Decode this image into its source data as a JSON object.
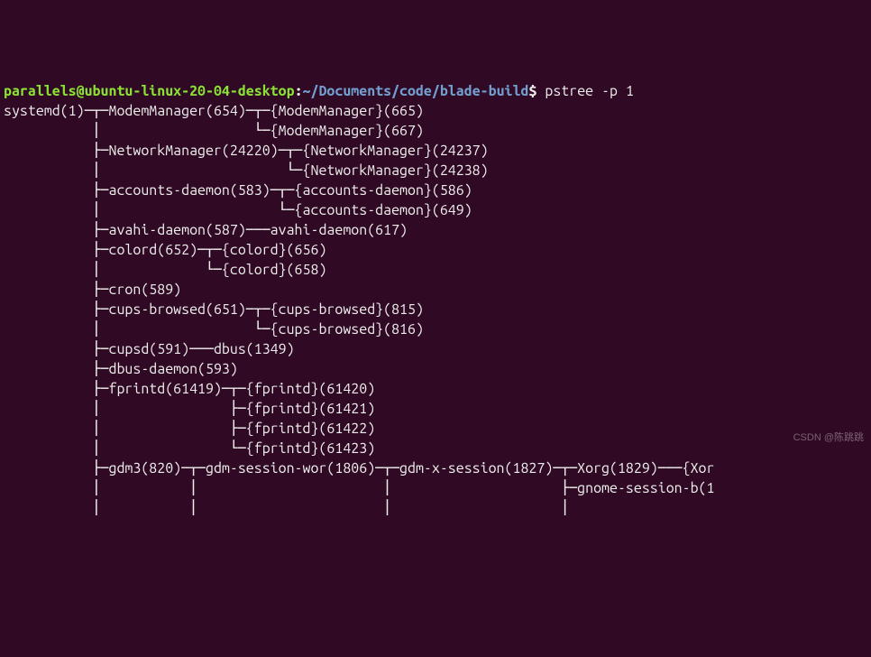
{
  "prompt": {
    "user_host": "parallels@ubuntu-linux-20-04-desktop",
    "colon": ":",
    "cwd": "~/Documents/code/blade-build",
    "dollar": "$",
    "command": "pstree -p 1"
  },
  "watermark": "CSDN @陈跳跳",
  "lines": [
    "systemd(1)─┬─ModemManager(654)─┬─{ModemManager}(665)",
    "           │                   └─{ModemManager}(667)",
    "           ├─NetworkManager(24220)─┬─{NetworkManager}(24237)",
    "           │                       └─{NetworkManager}(24238)",
    "           ├─accounts-daemon(583)─┬─{accounts-daemon}(586)",
    "           │                      └─{accounts-daemon}(649)",
    "           ├─avahi-daemon(587)───avahi-daemon(617)",
    "           ├─colord(652)─┬─{colord}(656)",
    "           │             └─{colord}(658)",
    "           ├─cron(589)",
    "           ├─cups-browsed(651)─┬─{cups-browsed}(815)",
    "           │                   └─{cups-browsed}(816)",
    "           ├─cupsd(591)───dbus(1349)",
    "           ├─dbus-daemon(593)",
    "           ├─fprintd(61419)─┬─{fprintd}(61420)",
    "           │                ├─{fprintd}(61421)",
    "           │                ├─{fprintd}(61422)",
    "           │                └─{fprintd}(61423)",
    "           ├─gdm3(820)─┬─gdm-session-wor(1806)─┬─gdm-x-session(1827)─┬─Xorg(1829)───{Xor",
    "           │           │                       │                     ├─gnome-session-b(1",
    "           │           │                       │                     │                   "
  ]
}
